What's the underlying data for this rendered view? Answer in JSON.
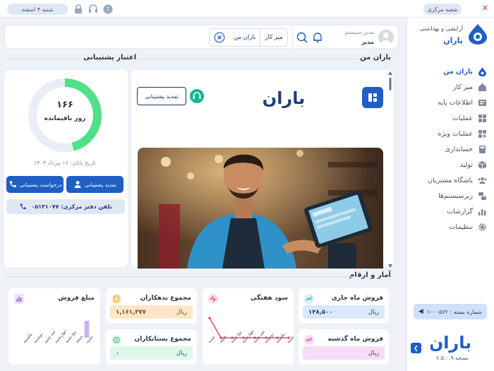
{
  "topbar": {
    "branch_pill": "شعبه مرکزی",
    "date_pill": "شنبه ۴ اسفند"
  },
  "brand": {
    "subtitle": "آرایشی و بهداشتی",
    "name": "باران"
  },
  "header": {
    "user_role": "مدیر سیستم",
    "user_name": "مدیر",
    "chip_label": "میز کار",
    "chip_value": "باران من"
  },
  "sidebar": {
    "items": [
      {
        "label": "باران من",
        "icon": "drop-icon"
      },
      {
        "label": "میز کار",
        "icon": "home-icon"
      },
      {
        "label": "اطلاعات پایه",
        "icon": "database-icon"
      },
      {
        "label": "عملیات",
        "icon": "grid-icon"
      },
      {
        "label": "عملیات ویژه",
        "icon": "grid-plus-icon"
      },
      {
        "label": "حسابداری",
        "icon": "calculator-icon"
      },
      {
        "label": "تولید",
        "icon": "box-icon"
      },
      {
        "label": "باشگاه مشتریان",
        "icon": "users-icon"
      },
      {
        "label": "زیرسیستم‌ها",
        "icon": "subsystem-icon"
      },
      {
        "label": "گزارشات",
        "icon": "chart-icon"
      },
      {
        "label": "تنظیمات",
        "icon": "gear-icon"
      }
    ],
    "branch_button": "شماره بسته : ۱۰۰۰۵۶۲",
    "version": "نسخه ۶.۵.۰.۹",
    "footer_brand": "باران"
  },
  "sections": {
    "baran_man": "باران من",
    "support": "اعتبار پشتیبانی",
    "stats": "آمار و ارقام"
  },
  "promo": {
    "brand": "باران",
    "renew_button": "تمدید پشتیبانی"
  },
  "support": {
    "days": "۱۶۶",
    "days_label": "روز باقیمانده",
    "days_fraction": 0.46,
    "expire_date": "تاریخ پایان: ۱۶ مرداد ۱۴۰۴",
    "renew_button": "تمدید پشتیبانی",
    "request_button": "درخواست پشتیبانی",
    "phone": "تلفن دفتر مرکزی: ۰۵۱۳۱۰۷۷"
  },
  "stats": {
    "current_month": {
      "title": "فروش ماه جاری",
      "value": "۱۴۸,۵۰۰",
      "unit": "ریال"
    },
    "last_month": {
      "title": "فروش ماه گذشته",
      "value": "",
      "unit": "ریال"
    },
    "weekly_profit": {
      "title": "سود هفتگی"
    },
    "debtors": {
      "title": "مجموع بدهکاران",
      "value": "۱,۱۶۱,۳۷۷",
      "unit": "ریال"
    },
    "creditors": {
      "title": "مجموع بستانکاران",
      "value": "۰",
      "unit": "ریال"
    },
    "sales_amount": {
      "title": "مبلغ فروش"
    }
  },
  "colors": {
    "primary": "#1f5fc4",
    "ring": "#4fe08a",
    "green_soft": "#dff7ea",
    "blue_soft": "#dbe8f9",
    "orange_soft": "#fde6c8",
    "pink_soft": "#f6dcf6",
    "profit_line": "#ee4d63"
  },
  "chart_data": [
    {
      "type": "line",
      "title": "سود هفتگی",
      "categories": [
        "شنبه",
        "یکشنبه",
        "دوشنبه",
        "سه شنبه",
        "چهارشنبه",
        "پنج شنبه",
        "جمعه",
        "شنبه"
      ],
      "values": [
        0,
        0,
        0,
        0,
        0,
        0,
        0,
        1
      ]
    },
    {
      "type": "bar",
      "title": "مبلغ فروش",
      "categories": [
        "یکشنبه",
        "دوشنبه",
        "سه شنبه",
        "چهارشنبه",
        "پنج شنبه",
        "جمعه",
        "شنبه"
      ],
      "values": [
        0,
        0,
        0,
        0,
        0,
        0,
        1
      ]
    }
  ]
}
